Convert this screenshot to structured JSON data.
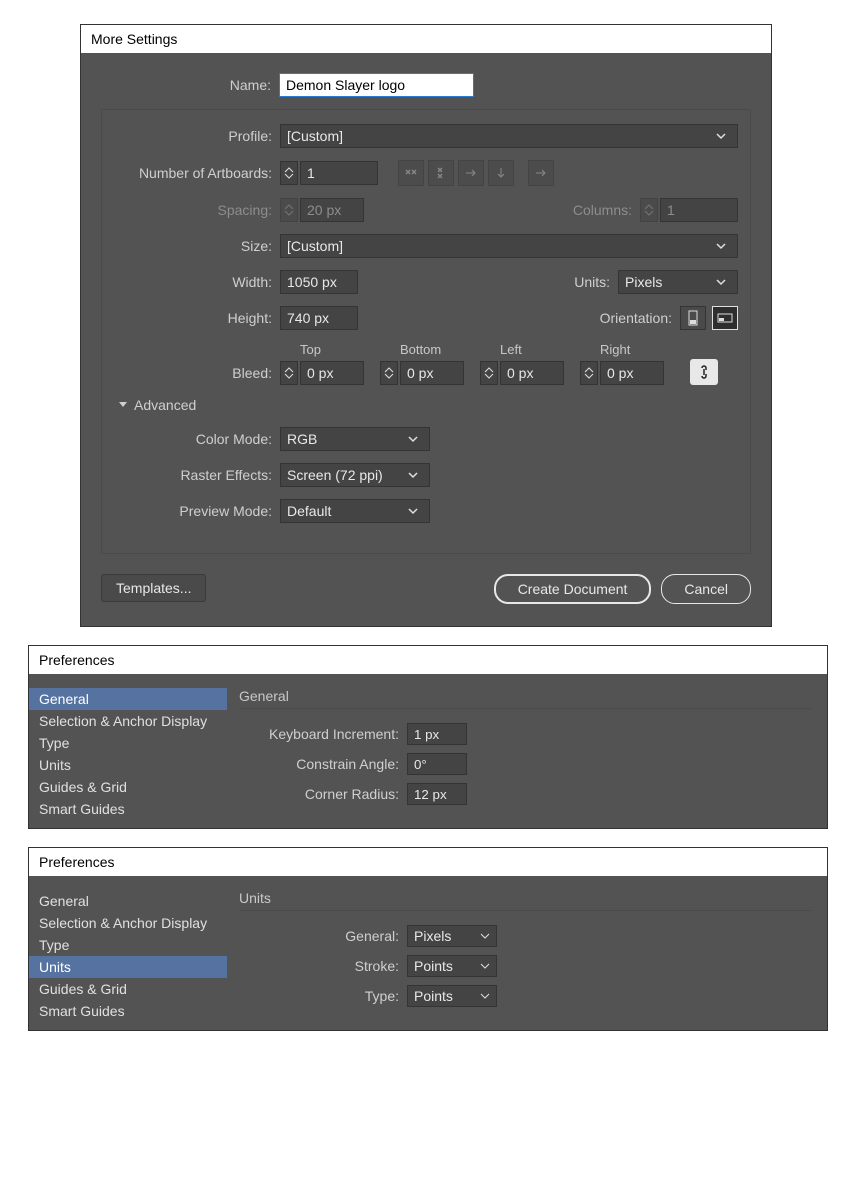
{
  "moreSettings": {
    "title": "More Settings",
    "labels": {
      "name": "Name:",
      "profile": "Profile:",
      "numArtboards": "Number of Artboards:",
      "spacing": "Spacing:",
      "columns": "Columns:",
      "size": "Size:",
      "width": "Width:",
      "units": "Units:",
      "height": "Height:",
      "orientation": "Orientation:",
      "bleed": "Bleed:",
      "bleedTop": "Top",
      "bleedBottom": "Bottom",
      "bleedLeft": "Left",
      "bleedRight": "Right",
      "colorMode": "Color Mode:",
      "rasterEffects": "Raster Effects:",
      "previewMode": "Preview Mode:",
      "advanced": "Advanced"
    },
    "values": {
      "name": "Demon Slayer logo",
      "profile": "[Custom]",
      "numArtboards": "1",
      "spacing": "20 px",
      "columns": "1",
      "size": "[Custom]",
      "width": "1050 px",
      "units": "Pixels",
      "height": "740 px",
      "bleedTop": "0 px",
      "bleedBottom": "0 px",
      "bleedLeft": "0 px",
      "bleedRight": "0 px",
      "colorMode": "RGB",
      "rasterEffects": "Screen (72 ppi)",
      "previewMode": "Default"
    },
    "buttons": {
      "templates": "Templates...",
      "create": "Create Document",
      "cancel": "Cancel"
    }
  },
  "prefsGeneral": {
    "title": "Preferences",
    "nav": [
      "General",
      "Selection & Anchor Display",
      "Type",
      "Units",
      "Guides & Grid",
      "Smart Guides"
    ],
    "selected": "General",
    "header": "General",
    "rows": {
      "keyboardIncrementLabel": "Keyboard Increment:",
      "keyboardIncrement": "1 px",
      "constrainAngleLabel": "Constrain Angle:",
      "constrainAngle": "0°",
      "cornerRadiusLabel": "Corner Radius:",
      "cornerRadius": "12 px"
    }
  },
  "prefsUnits": {
    "title": "Preferences",
    "nav": [
      "General",
      "Selection & Anchor Display",
      "Type",
      "Units",
      "Guides & Grid",
      "Smart Guides"
    ],
    "selected": "Units",
    "header": "Units",
    "rows": {
      "generalLabel": "General:",
      "general": "Pixels",
      "strokeLabel": "Stroke:",
      "stroke": "Points",
      "typeLabel": "Type:",
      "type": "Points"
    }
  }
}
